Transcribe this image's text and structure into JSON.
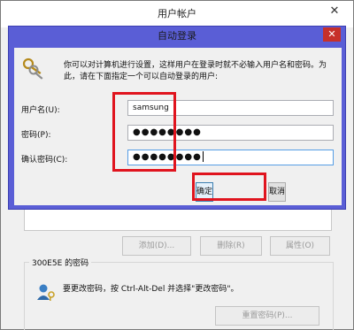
{
  "background_window": {
    "title": "用户帐户",
    "close_glyph": "✕",
    "buttons": {
      "add": "添加(D)...",
      "remove": "删除(R)",
      "properties": "属性(O)"
    },
    "password_group": {
      "title": "300E5E 的密码",
      "text": "要更改密码，按 Ctrl-Alt-Del 并选择\"更改密码\"。",
      "reset_button": "重置密码(P)..."
    }
  },
  "dialog": {
    "title": "自动登录",
    "close_glyph": "✕",
    "description": "你可以对计算机进行设置，这样用户在登录时就不必输入用户名和密码。为此，请在下面指定一个可以自动登录的用户:",
    "fields": {
      "username_label": "用户名(U):",
      "username_value": "samsung",
      "password_label": "密码(P):",
      "password_value": "●●●●●●●●",
      "confirm_label": "确认密码(C):",
      "confirm_value": "●●●●●●●●"
    },
    "buttons": {
      "ok": "确定",
      "cancel": "取消"
    }
  },
  "colors": {
    "dialog_frame": "#5a5ed6",
    "highlight": "#e0141e",
    "close_button": "#c7302a"
  },
  "icons": {
    "dialog_icon": "keys-icon",
    "user_icon": "user-key-icon"
  }
}
